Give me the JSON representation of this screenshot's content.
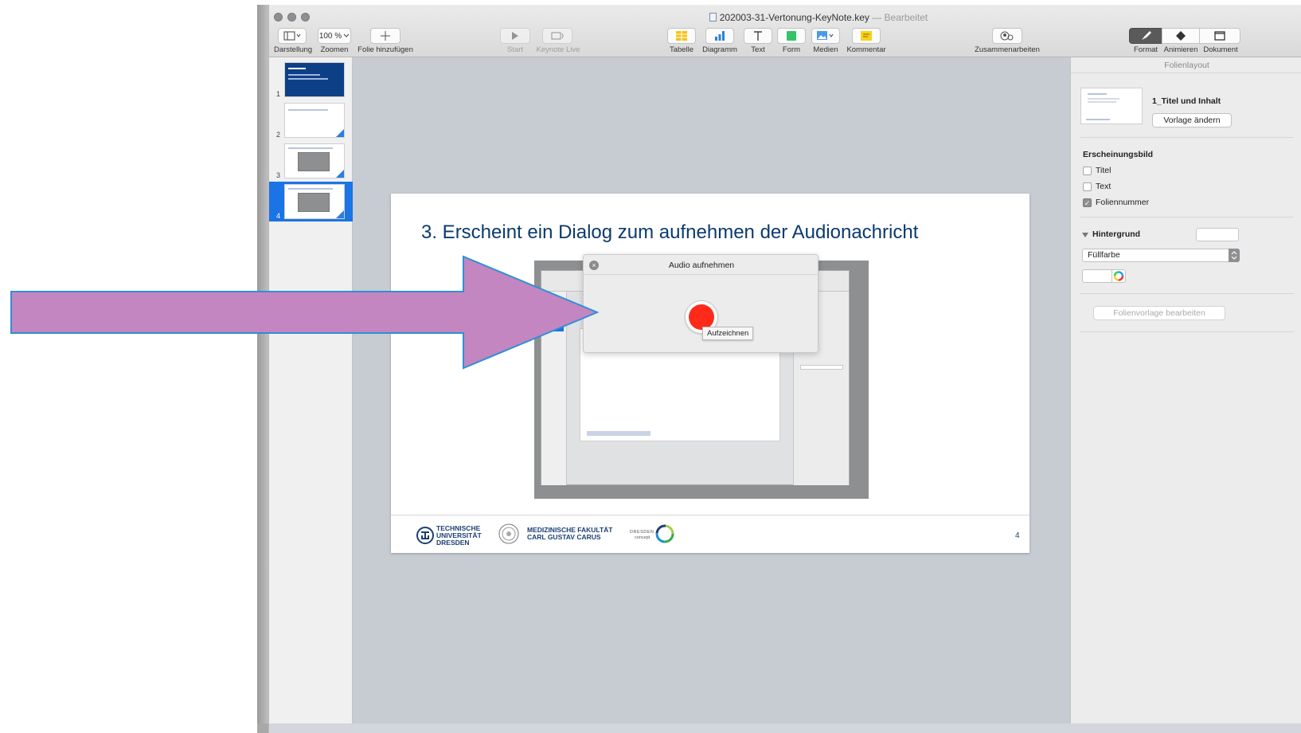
{
  "window": {
    "title": "202003-31-Vertonung-KeyNote.key",
    "status": "— Bearbeitet"
  },
  "toolbar": {
    "view_label": "Darstellung",
    "zoom_value": "100 %",
    "zoom_label": "Zoomen",
    "add_slide_label": "Folie hinzufügen",
    "play_label": "Start",
    "keynote_live_label": "Keynote Live",
    "table_label": "Tabelle",
    "chart_label": "Diagramm",
    "text_label": "Text",
    "shape_label": "Form",
    "media_label": "Medien",
    "comment_label": "Kommentar",
    "collaborate_label": "Zusammenarbeiten",
    "format_label": "Format",
    "animate_label": "Animieren",
    "document_label": "Dokument"
  },
  "slides": [
    {
      "number": "1"
    },
    {
      "number": "2"
    },
    {
      "number": "3"
    },
    {
      "number": "4"
    }
  ],
  "slide": {
    "title": "3. Erscheint ein Dialog zum aufnehmen der Audionachricht",
    "page_number": "4",
    "logos": {
      "tud_line1": "TECHNISCHE",
      "tud_line2": "UNIVERSITÄT",
      "tud_line3": "DRESDEN",
      "med_line1": "MEDIZINISCHE FAKULTÄT",
      "med_line2": "CARL GUSTAV CARUS",
      "concept_line1": "DRESDEN",
      "concept_line2": "concept"
    }
  },
  "dialog": {
    "title": "Audio aufnehmen",
    "tooltip": "Aufzeichnen"
  },
  "inspector": {
    "header": "Folienlayout",
    "layout_name": "1_Titel und Inhalt",
    "change_master": "Vorlage ändern",
    "appearance_label": "Erscheinungsbild",
    "title_label": "Titel",
    "text_label": "Text",
    "slide_number_label": "Foliennummer",
    "background_label": "Hintergrund",
    "fill_label": "Füllfarbe",
    "edit_master": "Folienvorlage bearbeiten"
  },
  "colors": {
    "annotation_arrow": "#c486c0",
    "arrow_outline": "#2f8fd6",
    "selection": "#1a74e6",
    "record": "#ff2a1a",
    "title_blue": "#0b3a6e"
  }
}
